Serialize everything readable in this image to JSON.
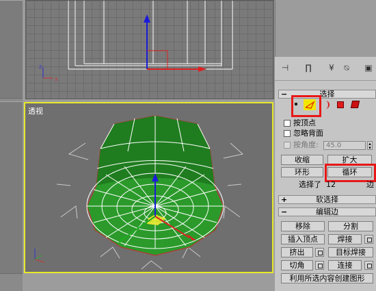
{
  "viewport": {
    "perspective_label": "透视"
  },
  "panel": {
    "toolbar_icons": [
      "pin-stack-icon",
      "modifier-icon",
      "fork-icon",
      "lock-icon",
      "configure-icon"
    ],
    "selection": {
      "header": "选择",
      "levels": [
        "vertex-icon",
        "edge-icon",
        "border-icon",
        "polygon-icon",
        "element-icon"
      ],
      "by_vertex": "按顶点",
      "ignore_backfacing": "忽略背面",
      "by_angle": "按角度:",
      "angle_value": "45.0",
      "shrink": "收缩",
      "grow": "扩大",
      "ring": "环形",
      "loop": "循环",
      "status_a": "选择了",
      "status_b": "12",
      "status_c": "边"
    },
    "soft_selection": {
      "header": "软选择"
    },
    "edit_edges": {
      "header": "编辑边",
      "remove": "移除",
      "split": "分割",
      "insert_vertex": "插入顶点",
      "weld": "焊接",
      "extrude": "挤出",
      "target_weld": "目标焊接",
      "chamfer": "切角",
      "connect": "连接",
      "create_shape": "利用所选内容创建图形"
    }
  },
  "colors": {
    "highlight": "#e81717",
    "active_viewport": "#e8e82c",
    "mesh": "#2aa52a"
  }
}
